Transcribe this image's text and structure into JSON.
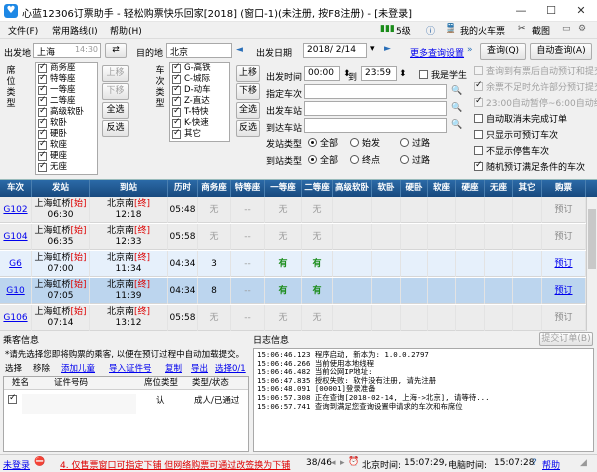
{
  "window": {
    "title": "心蓝12306订票助手 - 轻松购票快乐回家[2018] (窗口-1)(未注册, 按F8注册) - [未登录]",
    "app_icon": "heart-app-icon"
  },
  "menu": {
    "items": [
      "文件(F)",
      "常用路线(I)",
      "帮助(H)"
    ],
    "level": "5级",
    "my_ticket": "我的火车票",
    "screenshot": "截图"
  },
  "search": {
    "from_label": "出发地",
    "from_value": "上海",
    "from_time": "14:30",
    "to_label": "目的地",
    "to_value": "北京",
    "date_label": "出发日期",
    "date_value": "2018/ 2/14",
    "more_settings": "更多查询设置",
    "query_btn": "查询(Q)",
    "auto_query_btn": "自动查询(A)"
  },
  "seat_types": {
    "label": "席位类型",
    "items": [
      {
        "name": "商务座",
        "checked": true
      },
      {
        "name": "特等座",
        "checked": true
      },
      {
        "name": "一等座",
        "checked": true
      },
      {
        "name": "二等座",
        "checked": true
      },
      {
        "name": "高级软卧",
        "checked": true
      },
      {
        "name": "软卧",
        "checked": true
      },
      {
        "name": "硬卧",
        "checked": true
      },
      {
        "name": "软座",
        "checked": true
      },
      {
        "name": "硬座",
        "checked": true
      },
      {
        "name": "无座",
        "checked": true
      }
    ],
    "up": "上移",
    "down": "下移",
    "select_all": "全选",
    "invert": "反选"
  },
  "train_types": {
    "label": "车次类型",
    "items": [
      {
        "name": "G-高铁",
        "checked": true
      },
      {
        "name": "C-城际",
        "checked": true
      },
      {
        "name": "D-动车",
        "checked": true
      },
      {
        "name": "Z-直达",
        "checked": true
      },
      {
        "name": "T-特快",
        "checked": true
      },
      {
        "name": "K-快速",
        "checked": true
      },
      {
        "name": "其它",
        "checked": true
      }
    ],
    "up": "上移",
    "down": "下移",
    "select_all": "全选",
    "invert": "反选"
  },
  "filters": {
    "depart_time_label": "出发时间",
    "time_from": "00:00",
    "time_to_label": "到",
    "time_to": "23:59",
    "student": "我是学生",
    "train_no_label": "指定车次",
    "depart_station_label": "出发车站",
    "arrive_station_label": "到达车站",
    "depart_type_label": "发站类型",
    "arrive_type_label": "到站类型",
    "opt_all": "全部",
    "opt_origin": "始发",
    "opt_end": "终点",
    "opt_pass": "过路"
  },
  "right_options": [
    {
      "label": "查询到有票后自动预订和提交",
      "checked": false,
      "disabled": true
    },
    {
      "label": "余票不足时允许部分预订提交",
      "checked": true,
      "disabled": true
    },
    {
      "label": "23:00自动暂停~6:00自动继续",
      "checked": true,
      "disabled": true
    },
    {
      "label": "自动取消未完成订单",
      "checked": false,
      "disabled": false
    },
    {
      "label": "只显示可预订车次",
      "checked": false,
      "disabled": false
    },
    {
      "label": "不显示停售车次",
      "checked": false,
      "disabled": false
    },
    {
      "label": "随机预订满足条件的车次",
      "checked": true,
      "disabled": false
    }
  ],
  "table": {
    "headers": [
      "车次",
      "发站",
      "到站",
      "历时",
      "商务座",
      "特等座",
      "一等座",
      "二等座",
      "高级软卧",
      "软卧",
      "硬卧",
      "软座",
      "硬座",
      "无座",
      "其它",
      "购票"
    ],
    "rows": [
      {
        "no": "G102",
        "from": "上海虹桥",
        "from_tag": "[始]",
        "dep": "06:30",
        "to": "北京南",
        "to_tag": "[终]",
        "arr": "12:18",
        "dur": "05:48",
        "biz": "无",
        "spec": "--",
        "first": "无",
        "second": "无",
        "book": "预订",
        "book_gray": true,
        "bg": "#ececec"
      },
      {
        "no": "G104",
        "from": "上海虹桥",
        "from_tag": "[始]",
        "dep": "06:35",
        "to": "北京南",
        "to_tag": "[终]",
        "arr": "12:33",
        "dur": "05:58",
        "biz": "无",
        "spec": "--",
        "first": "无",
        "second": "无",
        "book": "预订",
        "book_gray": true,
        "bg": "#ececec"
      },
      {
        "no": "G6",
        "from": "上海虹桥",
        "from_tag": "[始]",
        "dep": "07:00",
        "to": "北京南",
        "to_tag": "[终]",
        "arr": "11:34",
        "dur": "04:34",
        "biz": "3",
        "spec": "--",
        "first": "有",
        "second": "有",
        "book": "预订",
        "book_gray": false,
        "bg": "#e6f0fb"
      },
      {
        "no": "G10",
        "from": "上海虹桥",
        "from_tag": "[始]",
        "dep": "07:05",
        "to": "北京南",
        "to_tag": "[终]",
        "arr": "11:39",
        "dur": "04:34",
        "biz": "8",
        "spec": "--",
        "first": "有",
        "second": "有",
        "book": "预订",
        "book_gray": false,
        "bg": "#bcd5ee"
      },
      {
        "no": "G106",
        "from": "上海虹桥",
        "from_tag": "[始]",
        "dep": "07:14",
        "to": "北京南",
        "to_tag": "[终]",
        "arr": "13:12",
        "dur": "05:58",
        "biz": "无",
        "spec": "--",
        "first": "无",
        "second": "无",
        "book": "预订",
        "book_gray": true,
        "bg": "#ececec"
      }
    ]
  },
  "passengers": {
    "title": "乘客信息",
    "hint": "*请先选择您即将购票的乘客, 以便在预订过程中自动加载提交。",
    "actions": [
      "选择",
      "移除",
      "添加儿童",
      "导入证件号",
      "复制",
      "导出",
      "选择0/1"
    ],
    "columns": [
      "姓名",
      "证件号码",
      "席位类型",
      "类型/状态"
    ],
    "row": {
      "seat": "认",
      "status": "成人/已通过"
    }
  },
  "log": {
    "title": "日志信息",
    "submit_btn": "提交订单(B)",
    "lines": [
      "15:06:46.123 程序启动, 新本为: 1.0.0.2797",
      "15:06:46.266 当前使用本地线程",
      "15:06:46.482 当前公网IP地址:",
      "15:06:47.835 授权失败: 软件没有注册, 请先注册",
      "15:06:48.091 [00001]登录准备",
      "15:06:57.308 正在查询[2018-02-14, 上海->北京], 请等待...",
      "15:06:57.741 查询到满足您查询设置申请求的车次和布席位"
    ]
  },
  "status": {
    "login": "未登录",
    "notice": "4. 仅售票窗口可指定下铺 但网络购票可通过改签换为下铺",
    "count": "38/46",
    "beijing_label": "北京时间:",
    "beijing_time": "15:07:29,",
    "pc_label": "电脑时间:",
    "pc_time": "15:07:28",
    "help": "帮助"
  }
}
